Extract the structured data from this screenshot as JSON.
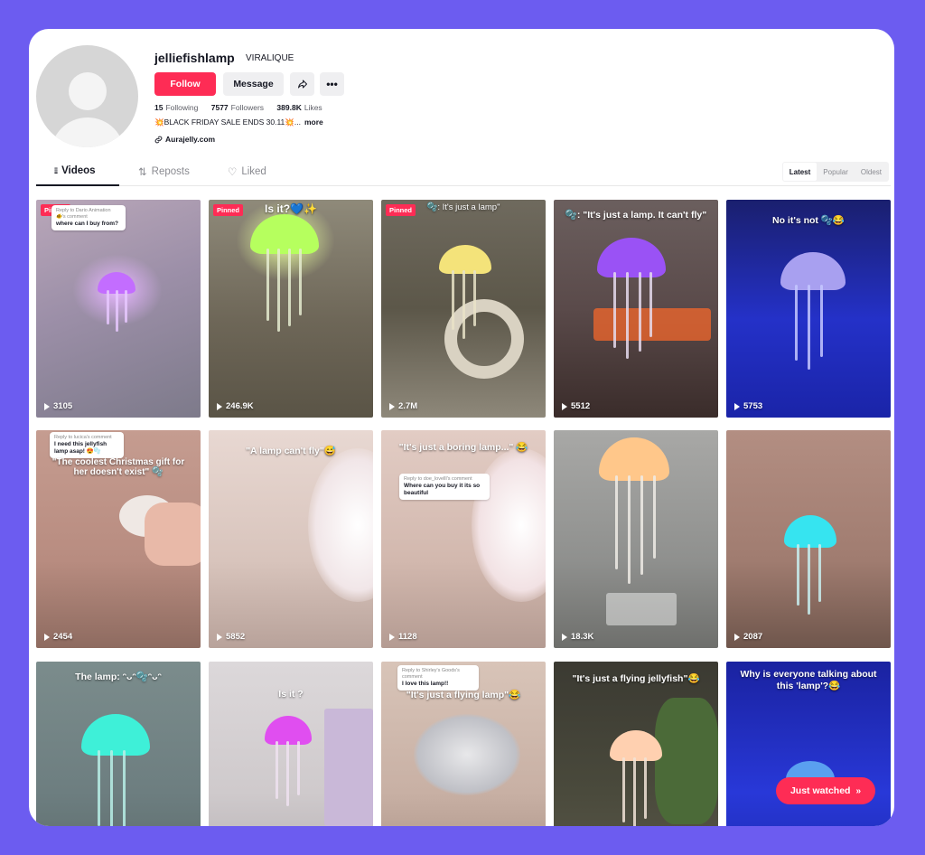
{
  "profile": {
    "username": "jelliefishlamp",
    "nickname": "VIRALIQUE",
    "follow_label": "Follow",
    "message_label": "Message",
    "share_icon": "share-icon",
    "more_icon": "more-icon",
    "following_count": "15",
    "following_label": "Following",
    "followers_count": "7577",
    "followers_label": "Followers",
    "likes_count": "389.8K",
    "likes_label": "Likes",
    "bio": "💥BLACK FRIDAY SALE ENDS 30.11💥...",
    "bio_more": "more",
    "link": "Aurajelly.com"
  },
  "tabs": {
    "videos": "Videos",
    "reposts": "Reposts",
    "liked": "Liked"
  },
  "sort": {
    "latest": "Latest",
    "popular": "Popular",
    "oldest": "Oldest"
  },
  "pinned_label": "Pinned",
  "videos": [
    {
      "views": "3105",
      "caption": "",
      "reply_small": "Reply to Dario Animation 🐠's comment",
      "reply": "where can I buy from?"
    },
    {
      "views": "246.9K",
      "caption": "Is it?💙✨"
    },
    {
      "views": "2.7M",
      "caption": "🫧: It's just a lamp\""
    },
    {
      "views": "5512",
      "caption": "🫧: \"It's just a lamp. It can't fly\""
    },
    {
      "views": "5753",
      "caption": "No it's not 🫧😂"
    },
    {
      "views": "2454",
      "caption": "\"The coolest Christmas gift for her doesn't exist\" 🫧",
      "reply_small": "Reply to lucica's comment",
      "reply": "I need this jellyfish lamp asap! 😍🫧"
    },
    {
      "views": "5852",
      "caption": "\"A lamp can't fly\"😅"
    },
    {
      "views": "1128",
      "caption": "\"It's just a boring lamp...\" 😂",
      "reply_small": "Reply to doe_lovelll's comment",
      "reply": "Where can you buy it its so beautiful"
    },
    {
      "views": "18.3K",
      "caption": ""
    },
    {
      "views": "2087",
      "caption": ""
    },
    {
      "views": "",
      "caption": "The lamp: ᵔᴗᵔ🫧ᵔᴗᵔ"
    },
    {
      "views": "",
      "caption": "Is it ?"
    },
    {
      "views": "",
      "caption": "\"It's just a flying lamp\"😂",
      "reply_small": "Reply to Shirley's Goods's comment",
      "reply": "I love this lamp!!"
    },
    {
      "views": "",
      "caption": "\"It's just a flying jellyfish\"😂"
    },
    {
      "views": "",
      "caption": "Why is everyone talking about this 'lamp'?😂"
    }
  ],
  "just_watched": "Just watched",
  "colors": {
    "brand": "#fe2c55",
    "page_bg": "#6c5cf0"
  }
}
